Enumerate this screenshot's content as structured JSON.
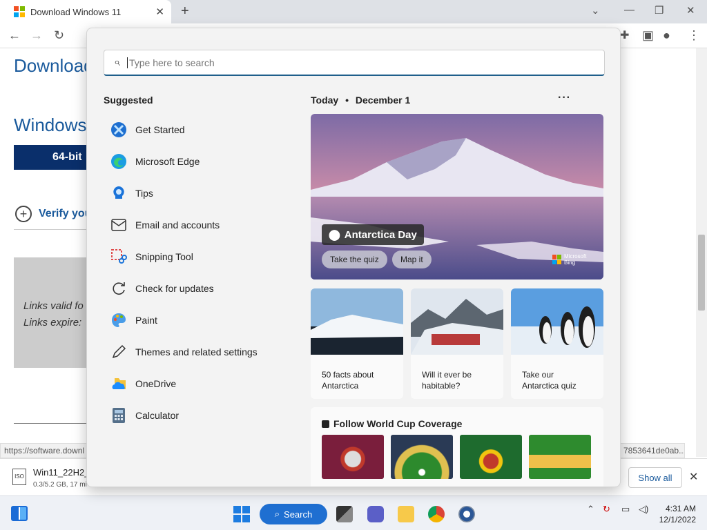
{
  "browser": {
    "tab_title": "Download Windows 11",
    "new_tab": "+",
    "win_controls": [
      "⌵",
      "—",
      "❐",
      "✕"
    ]
  },
  "page": {
    "title": "Download",
    "subtitle": "Windows",
    "download_btn": "64-bit",
    "verify": "Verify you",
    "links_line1": "Links valid fo",
    "links_line2": "Links expire:",
    "status_url": "https://software.downl",
    "status_url_right": "7853641de0ab..."
  },
  "download_bar": {
    "file_name": "Win11_22H2_",
    "progress": "0.3/5.2 GB, 17 mi",
    "show_all": "Show all"
  },
  "start_menu": {
    "search_placeholder": "Type here to search",
    "suggested_heading": "Suggested",
    "suggested": [
      {
        "label": "Get Started",
        "icon": "get-started-icon"
      },
      {
        "label": "Microsoft Edge",
        "icon": "edge-icon"
      },
      {
        "label": "Tips",
        "icon": "tips-icon"
      },
      {
        "label": "Email and accounts",
        "icon": "mail-icon"
      },
      {
        "label": "Snipping Tool",
        "icon": "snipping-tool-icon"
      },
      {
        "label": "Check for updates",
        "icon": "refresh-icon"
      },
      {
        "label": "Paint",
        "icon": "paint-icon"
      },
      {
        "label": "Themes and related settings",
        "icon": "pen-icon"
      },
      {
        "label": "OneDrive",
        "icon": "onedrive-icon"
      },
      {
        "label": "Calculator",
        "icon": "calculator-icon"
      }
    ],
    "today_label": "Today",
    "today_sep": "•",
    "today_date": "December 1",
    "more": "···",
    "hero": {
      "title": "Antarctica Day",
      "btn_quiz": "Take the quiz",
      "btn_map": "Map it",
      "bing_line1": "Microsoft",
      "bing_line2": "Bing"
    },
    "cards": [
      {
        "line1": "50 facts about",
        "line2": "Antarctica"
      },
      {
        "line1": "Will it ever be",
        "line2": "habitable?"
      },
      {
        "line1": "Take our",
        "line2": "Antarctica quiz"
      }
    ],
    "world_cup": "Follow World Cup Coverage"
  },
  "taskbar": {
    "search_label": "Search",
    "time": "4:31 AM",
    "date": "12/1/2022"
  },
  "colors": {
    "accent": "#1f6fd1",
    "page_link": "#1a5a9c",
    "ms_red": "#f25022",
    "ms_green": "#7fba00",
    "ms_blue": "#00a4ef",
    "ms_yellow": "#ffb900"
  }
}
